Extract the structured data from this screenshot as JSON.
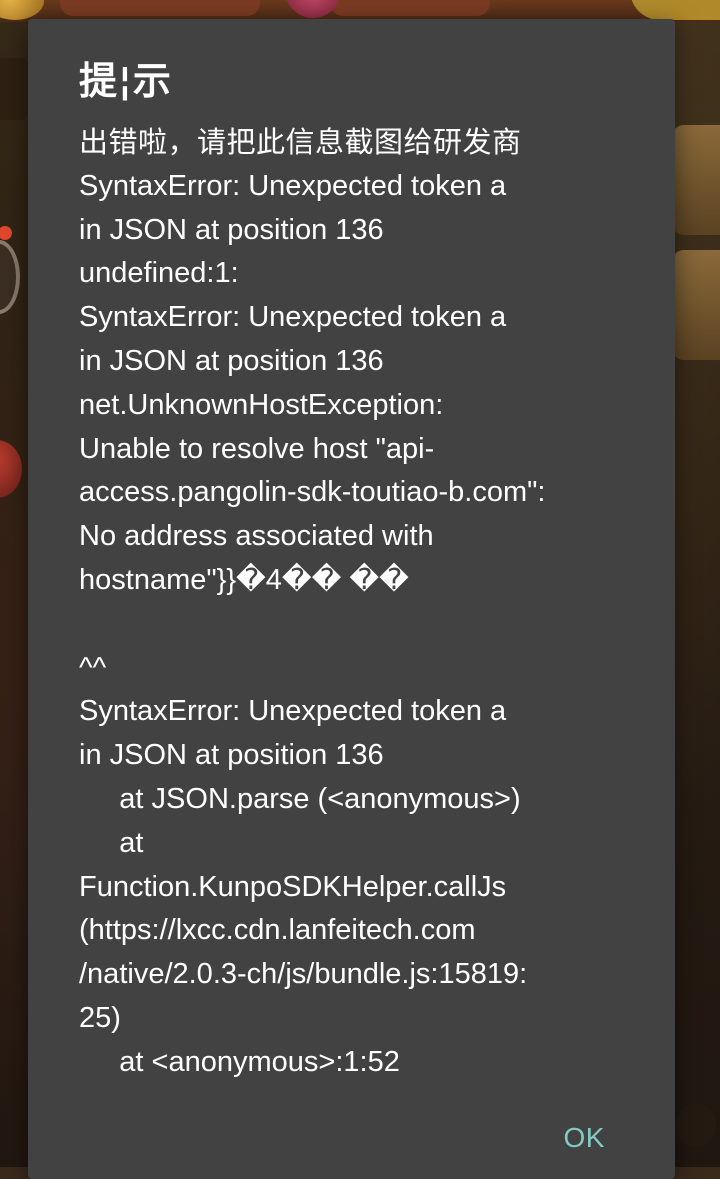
{
  "dialog": {
    "title": "提¦示",
    "message_lines": [
      "出错啦，请把此信息截图给研发商",
      "SyntaxError: Unexpected token a",
      "in JSON at position 136",
      "undefined:1:",
      "SyntaxError: Unexpected token a",
      "in JSON at position 136",
      "net.UnknownHostException:",
      "Unable to resolve host \"api-",
      "access.pangolin-sdk-toutiao-b.com\":",
      "No address associated with",
      "hostname\"}}�4�� ��",
      "",
      "^^",
      "SyntaxError: Unexpected token a",
      "in JSON at position 136",
      "     at JSON.parse (<anonymous>)",
      "     at",
      "Function.KunpoSDKHelper.callJs",
      "(https://lxcc.cdn.lanfeitech.com",
      "/native/2.0.3-ch/js/bundle.js:15819:",
      "25)",
      "     at <anonymous>:1:52"
    ],
    "ok_label": "OK"
  },
  "colors": {
    "dialog_bg": "#424242",
    "text": "#ffffff",
    "accent": "#80cbc4"
  }
}
